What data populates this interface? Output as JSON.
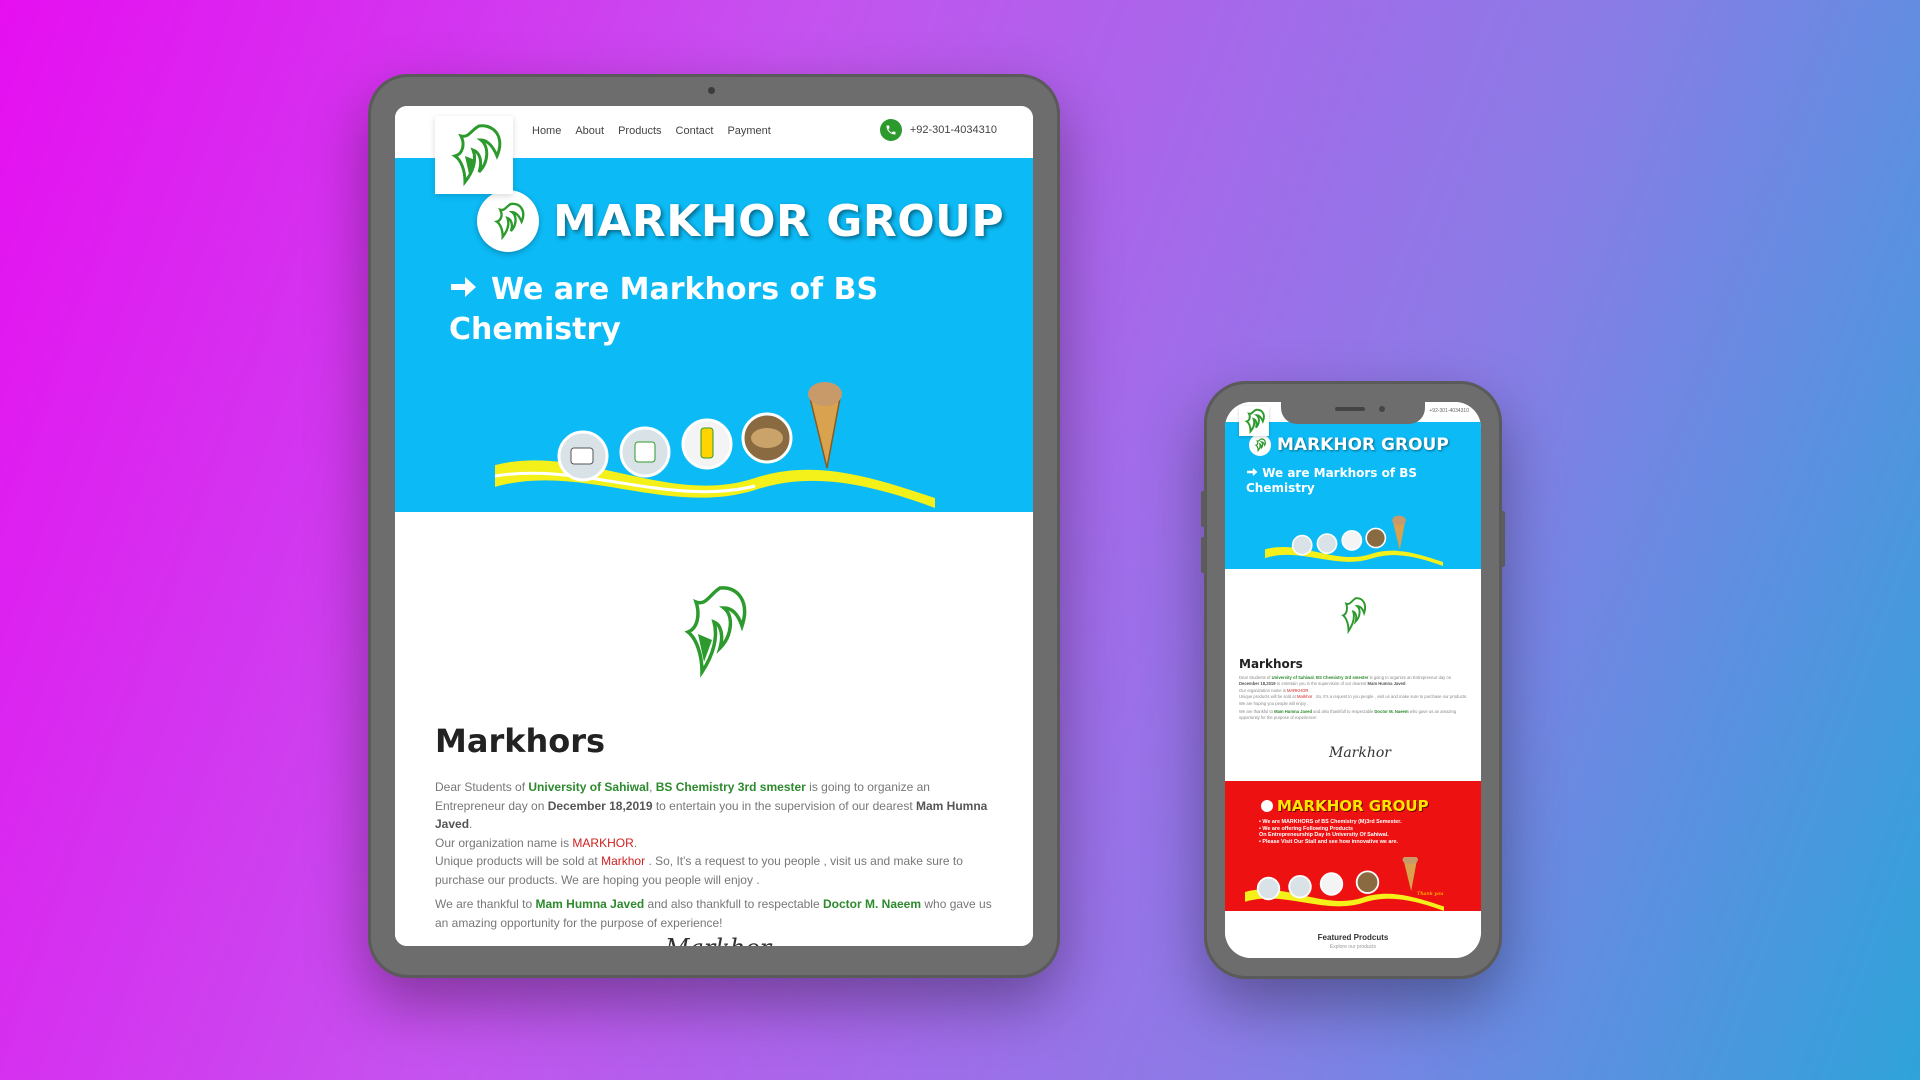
{
  "brand": {
    "name": "MARKHOR GROUP",
    "accent": "#0cbaf5",
    "green": "#2d8a2d",
    "red": "#ee1111",
    "yellow": "#ffe600"
  },
  "nav": {
    "items": [
      "Home",
      "About",
      "Products",
      "Contact",
      "Payment"
    ],
    "phone": "+92-301-4034310",
    "phone_icon": "phone-icon"
  },
  "hero": {
    "title": "MARKHOR GROUP",
    "subtitle": "We are Markhors of BS Chemistry"
  },
  "about": {
    "title": "Markhors",
    "p1": {
      "t1": "Dear Students of ",
      "l1": "University of Sahiwal",
      "t2": ", ",
      "l2": "BS Chemistry 3rd smester",
      "t3": " is going to organize an Entrepreneur day on ",
      "l3": "December 18,2019",
      "t4": " to entertain you in the supervision of our dearest ",
      "l4": "Mam Humna Javed",
      "t5": "."
    },
    "p1b": {
      "t1": "Our organization name is ",
      "l1": "MARKHOR",
      "t2": "."
    },
    "p1c": {
      "t1": "Unique products will be sold at ",
      "l1": "Markhor",
      "t2": " . So, It's a request to you people , visit us and make sure to purchase our products. We are hoping you people will enjoy ."
    },
    "p2": {
      "t1": "We are thankful to ",
      "l1": "Mam Humna Javed",
      "t2": " and also thankfull to respectable ",
      "l2": "Doctor M. Naeem",
      "t3": " who gave us an amazing opportunity for the purpose of experience!"
    },
    "signature": "Markhor"
  },
  "banner": {
    "title": "MARKHOR GROUP",
    "lines": [
      "• We are MARKHORS of BS Chemistry (M)3rd Semester.",
      "• We are offering Following Products",
      "   On Entrepreneurship Day in University Of Sahiwal.",
      "• Please Visit Our Stall and see how innovative we are."
    ],
    "thanks": "Thank you"
  },
  "featured": {
    "title": "Featured Prodcuts",
    "subtitle": "Explore our products"
  }
}
